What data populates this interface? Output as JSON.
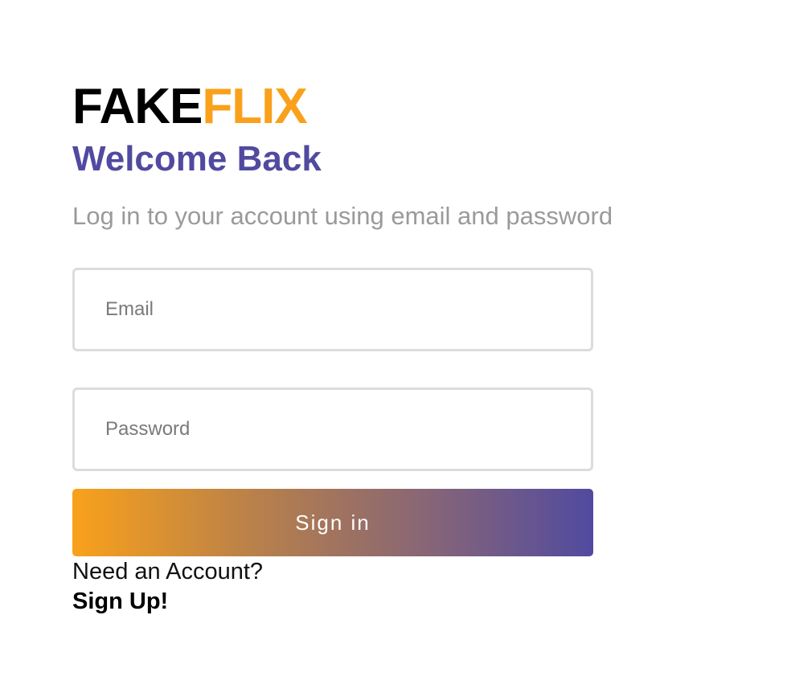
{
  "logo": {
    "part_a": "FAKE",
    "part_b": "FLIX"
  },
  "heading": "Welcome Back",
  "subtitle": "Log in to your account using email and password",
  "form": {
    "email_placeholder": "Email",
    "email_value": "",
    "password_placeholder": "Password",
    "password_value": "",
    "submit_label": "Sign in"
  },
  "footer": {
    "prompt": "Need an Account?",
    "signup_label": "Sign Up!"
  },
  "colors": {
    "brand_orange": "#f9a11b",
    "brand_purple": "#514aa0",
    "subtitle_gray": "#9a9a9a",
    "field_border": "#dcdcdc"
  }
}
